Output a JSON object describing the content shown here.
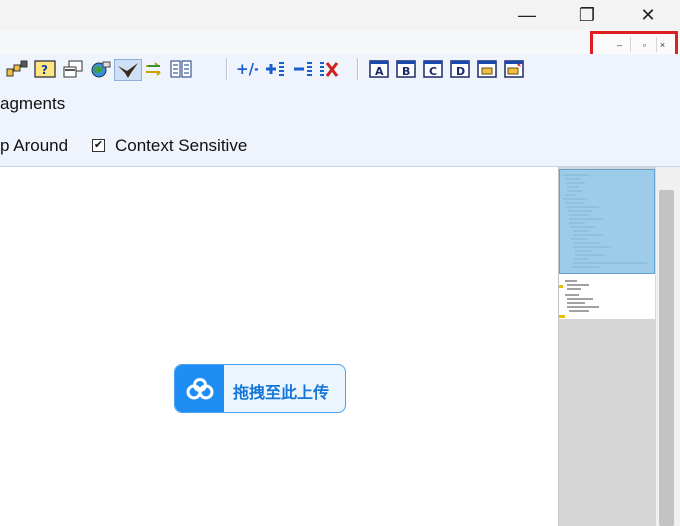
{
  "window": {
    "controls": {
      "minimize": "—",
      "restore": "❐",
      "close": "✕"
    }
  },
  "mdi_controls": {
    "minimize": "–",
    "restore": "▫",
    "close": "×",
    "highlight_color": "#e02020"
  },
  "toolbar": {
    "labels": {
      "fragments": "agments",
      "wrap_around": "p Around",
      "context_sensitive": "Context Sensitive"
    },
    "context_sensitive_checked": "✔",
    "letter_buttons": [
      "A",
      "B",
      "C",
      "D"
    ]
  },
  "upload_widget": {
    "label": "拖拽至此上传",
    "accent": "#1e8ef5"
  },
  "colors": {
    "toolbar_bg": "#eef3fc",
    "minimap_view": "#8cc4e8"
  }
}
